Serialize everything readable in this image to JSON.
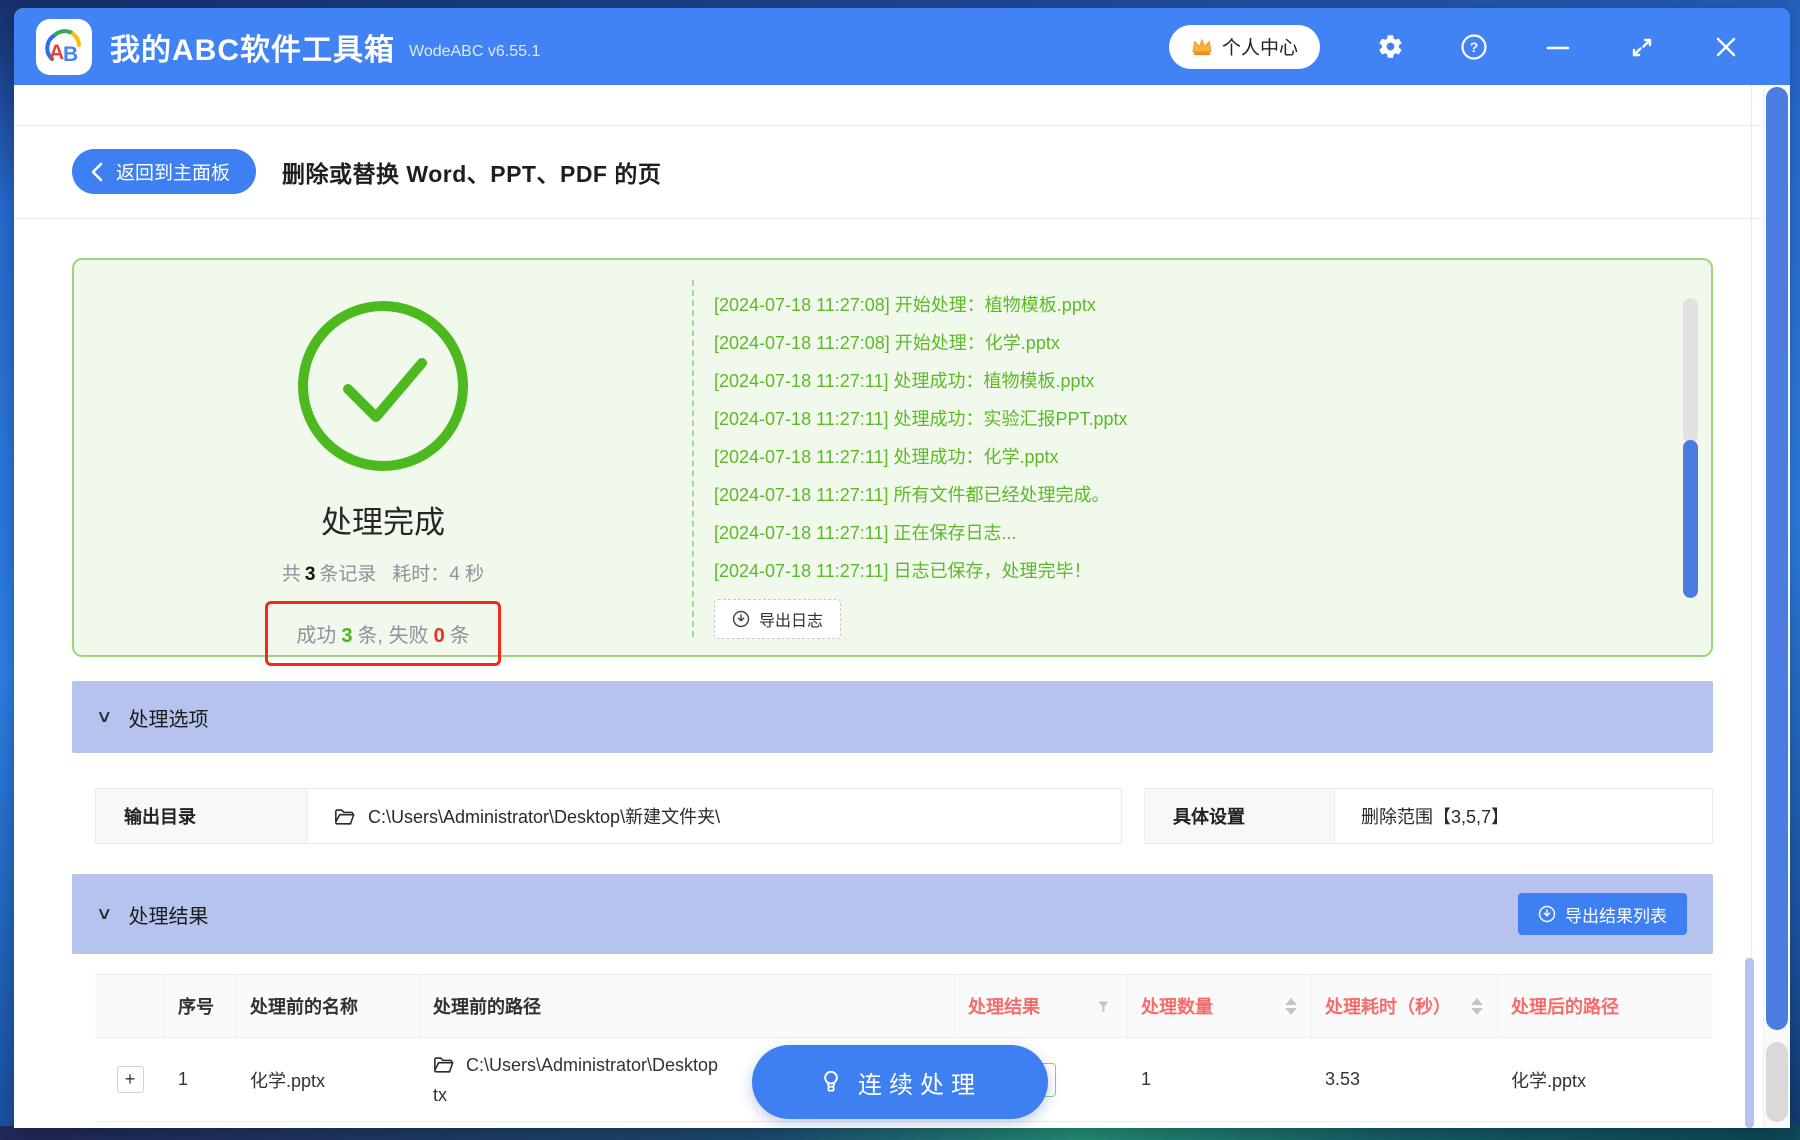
{
  "colors": {
    "titlebar_blue": "#4183f4",
    "accent_blue": "#3e7ff2",
    "success_green": "#4cba1f",
    "log_green": "#5eb928",
    "panel_bg": "#f0f9eb",
    "panel_border": "#9ed67f",
    "section_bar_lavender": "#b6c3ee",
    "error_red": "#f3291b",
    "table_header_red": "#f56c6c"
  },
  "icons": {
    "section_chevron": "∨"
  },
  "titlebar": {
    "logo_text": "AB",
    "app_title": "我的ABC软件工具箱",
    "version": "WodeABC v6.55.1",
    "user_center": "个人中心"
  },
  "header": {
    "back_label": "返回到主面板",
    "page_title": "删除或替换 Word、PPT、PDF 的页"
  },
  "result_panel": {
    "status": "处理完成",
    "summary": {
      "total_label": "共",
      "total_count": "3",
      "records_label": "条记录",
      "time_label": "耗时：",
      "time_value": "4",
      "time_unit": "秒"
    },
    "outcome": {
      "success_label": "成功",
      "success_count": "3",
      "success_unit": "条,",
      "fail_label": "失败",
      "fail_count": "0",
      "fail_unit": "条"
    },
    "logs": [
      "[2024-07-18 11:27:08] 开始处理：植物模板.pptx",
      "[2024-07-18 11:27:08] 开始处理：化学.pptx",
      "[2024-07-18 11:27:11] 处理成功：植物模板.pptx",
      "[2024-07-18 11:27:11] 处理成功：实验汇报PPT.pptx",
      "[2024-07-18 11:27:11] 处理成功：化学.pptx",
      "[2024-07-18 11:27:11] 所有文件都已经处理完成。",
      "[2024-07-18 11:27:11] 正在保存日志...",
      "[2024-07-18 11:27:11] 日志已保存，处理完毕！"
    ],
    "export_log_label": "导出日志"
  },
  "options": {
    "section_title": "处理选项",
    "output_label": "输出目录",
    "output_value": "C:\\Users\\Administrator\\Desktop\\新建文件夹\\",
    "settings_label": "具体设置",
    "settings_value": "删除范围【3,5,7】"
  },
  "results": {
    "section_title": "处理结果",
    "export_button": "导出结果列表",
    "table": {
      "headers": {
        "index": "序号",
        "name": "处理前的名称",
        "path": "处理前的路径",
        "result": "处理结果",
        "count": "处理数量",
        "time": "处理耗时（秒）",
        "out_path": "处理后的路径"
      },
      "row": {
        "expand": "+",
        "index": "1",
        "name": "化学.pptx",
        "path_line1": "C:\\Users\\Administrator\\Desktop",
        "path_line2": "tx",
        "count": "1",
        "time": "3.53",
        "out_path": "化学.pptx"
      }
    }
  },
  "continue_button": "连续处理"
}
